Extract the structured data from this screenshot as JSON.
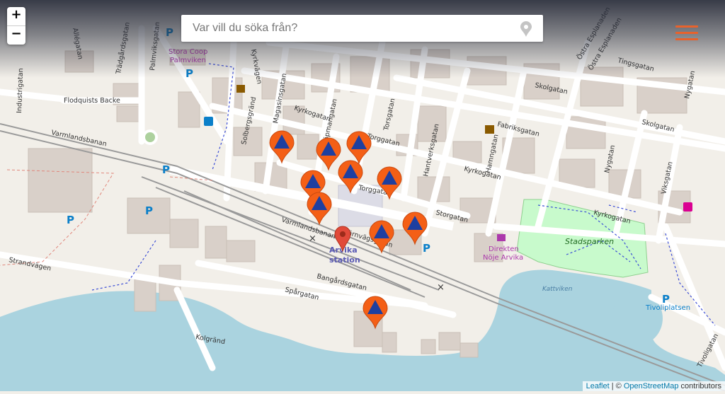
{
  "zoom": {
    "in_label": "+",
    "out_label": "−"
  },
  "search": {
    "placeholder": "Var vill du söka från?"
  },
  "attribution": {
    "leaflet": "Leaflet",
    "separator": " | © ",
    "osm": "OpenStreetMap",
    "suffix": " contributors"
  },
  "map": {
    "colors": {
      "land": "#f2efe9",
      "water": "#aad3df",
      "building": "#d9d0c9",
      "park": "#c8facc",
      "marker": "#f45f16",
      "marker_icon": "#1e3fa0",
      "station_marker": "#e14a3a"
    },
    "street_labels": {
      "kopmangatan": "Köpmangatan",
      "magasinsgatan": "Magasinsgatan",
      "kyrkogatan": "Kyrkogatan",
      "torggatan": "Torggatan",
      "torsgatan": "Torsgatan",
      "storgatan": "Storgatan",
      "hantverksgatan": "Hantverksgatan",
      "hamngatan": "Hamngatan",
      "fabriksgatan": "Fabriksgatan",
      "skolgatan": "Skolgatan",
      "tingsgatan": "Tingsgatan",
      "nygatan": "Nygatan",
      "viksgatan": "Viksgatan",
      "ostra_esplanaden": "Östra Esplanaden",
      "varmlandsbanan": "Varmlandsbanan",
      "jarnvagsgatan": "Järnvägsgatan",
      "bangardsgatan": "Bangårdsgatan",
      "spargatan": "Spårgatan",
      "strandvagen": "Strandvägen",
      "kolgrand": "Kolgränd",
      "tivoligatan": "Tivoligatan",
      "solbergsgrand": "Solbergsgränd",
      "industrigatan": "Industrigatan",
      "tradgardsgatan": "Trädgårdsgatan",
      "palmviksgatan": "Palmviksgatan",
      "flodquists": "Flodquists Backe",
      "kyrkvagen": "Kyrkvägen",
      "allegatan": "Allégatan"
    },
    "poi_labels": {
      "stora_coop": "Stora Coop",
      "palmviken": "Palmviken",
      "stadsparken": "Stadsparken",
      "kattviken": "Kattviken",
      "tivoliplatsen": "Tivoliplatsen",
      "arvika": "Arvika",
      "station": "station",
      "direkten": "Direkten",
      "noje_arvika": "Nöje Arvika"
    },
    "parking_label": "P",
    "shelter_marker_count": 11
  }
}
